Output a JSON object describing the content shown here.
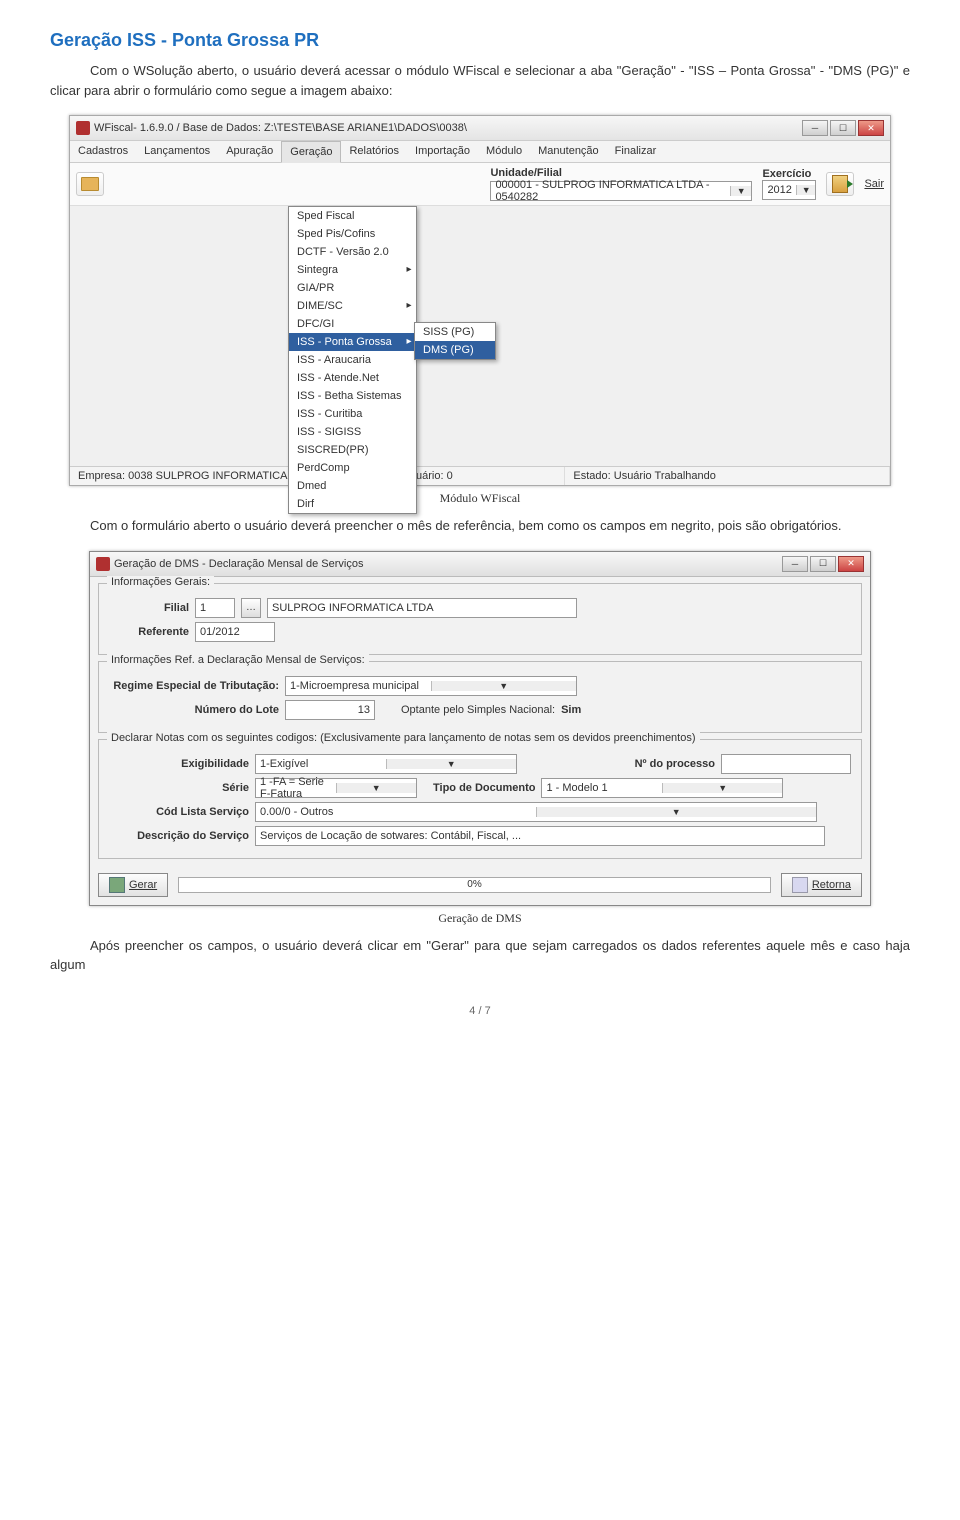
{
  "title": "Geração ISS - Ponta Grossa PR",
  "para1": "Com o WSolução aberto, o usuário deverá acessar o módulo WFiscal e selecionar a aba \"Geração\" - \"ISS – Ponta Grossa\" - \"DMS (PG)\" e clicar para abrir o formulário como segue a imagem abaixo:",
  "caption1": "Módulo WFiscal",
  "para2": "Com o formulário aberto o usuário deverá preencher o mês de referência, bem como os campos em negrito, pois são obrigatórios.",
  "caption2": "Geração de DMS",
  "para3": "Após preencher os campos, o usuário deverá clicar em \"Gerar\" para que sejam carregados os dados referentes aquele mês e caso haja algum",
  "pagenum": "4 / 7",
  "app": {
    "title": "WFiscal- 1.6.9.0 / Base de Dados: Z:\\TESTE\\BASE ARIANE1\\DADOS\\0038\\",
    "menus": [
      "Cadastros",
      "Lançamentos",
      "Apuração",
      "Geração",
      "Relatórios",
      "Importação",
      "Módulo",
      "Manutenção",
      "Finalizar"
    ],
    "unidade_label": "Unidade/Filial",
    "unidade_value": "000001 - SULPROG INFORMATICA LTDA - 0540282",
    "exercicio_label": "Exercício",
    "exercicio_value": "2012",
    "sair_label": "Sair",
    "dropdown": [
      {
        "label": "Sped Fiscal",
        "arrow": false
      },
      {
        "label": "Sped Pis/Cofins",
        "arrow": false
      },
      {
        "label": "DCTF - Versão 2.0",
        "arrow": false
      },
      {
        "label": "Sintegra",
        "arrow": true
      },
      {
        "label": "GIA/PR",
        "arrow": false
      },
      {
        "label": "DIME/SC",
        "arrow": true
      },
      {
        "label": "DFC/GI",
        "arrow": false
      },
      {
        "label": "ISS - Ponta Grossa",
        "arrow": true,
        "hl": true
      },
      {
        "label": "ISS - Araucaria",
        "arrow": false
      },
      {
        "label": "ISS - Atende.Net",
        "arrow": false
      },
      {
        "label": "ISS - Betha Sistemas",
        "arrow": false
      },
      {
        "label": "ISS - Curitiba",
        "arrow": false
      },
      {
        "label": "ISS - SIGISS",
        "arrow": false
      },
      {
        "label": "SISCRED(PR)",
        "arrow": false
      },
      {
        "label": "PerdComp",
        "arrow": false
      },
      {
        "label": "Dmed",
        "arrow": false
      },
      {
        "label": "Dirf",
        "arrow": false
      }
    ],
    "submenu": [
      {
        "label": "SISS (PG)",
        "hl": false
      },
      {
        "label": "DMS (PG)",
        "hl": true
      }
    ],
    "status_empresa": "Empresa: 0038 SULPROG INFORMATICA LTDA",
    "status_usuario": "Usuário: 0",
    "status_estado": "Estado: Usuário Trabalhando"
  },
  "form": {
    "title": "Geração de DMS - Declaração Mensal de Serviços",
    "grp1_legend": "Informações Gerais:",
    "filial_label": "Filial",
    "filial_value": "1",
    "filial_nome": "SULPROG INFORMATICA LTDA",
    "referente_label": "Referente",
    "referente_value": "01/2012",
    "grp2_legend": "Informações Ref. a Declaração Mensal de Serviços:",
    "regime_label": "Regime Especial de Tributação:",
    "regime_value": "1-Microempresa municipal",
    "lote_label": "Número do Lote",
    "lote_value": "13",
    "simples_label": "Optante pelo Simples Nacional:",
    "simples_value": "Sim",
    "grp3_legend": "Declarar Notas com os seguintes codigos: (Exclusivamente para lançamento de notas sem os devidos preenchimentos)",
    "exig_label": "Exigibilidade",
    "exig_value": "1-Exigível",
    "processo_label": "Nº do processo",
    "processo_value": "",
    "serie_label": "Série",
    "serie_value": "1 -FA  = Serie F-Fatura",
    "tipo_label": "Tipo de Documento",
    "tipo_value": "1 - Modelo 1",
    "codlista_label": "Cód Lista Serviço",
    "codlista_value": "0.00/0 - Outros",
    "desc_label": "Descrição do Serviço",
    "desc_value": "Serviços de Locação de sotwares: Contábil, Fiscal, ...",
    "gerar_label": "Gerar",
    "progress": "0%",
    "retorna_label": "Retorna"
  }
}
